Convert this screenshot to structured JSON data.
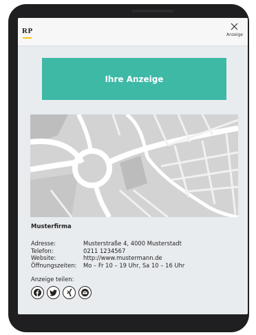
{
  "header": {
    "logo_text": "RP",
    "close_label": "Anzeige",
    "icons": {
      "close": "close-icon"
    }
  },
  "ad": {
    "label": "Ihre Anzeige",
    "color": "#3db9a6"
  },
  "company": {
    "name": "Musterfirma",
    "rows": [
      {
        "label": "Adresse:",
        "value": "Musterstraße 4, 4000 Musterstadt"
      },
      {
        "label": "Telefon:",
        "value": "0211 1234567"
      },
      {
        "label": "Website:",
        "value": "http://www.mustermann.de"
      },
      {
        "label": "Öffnungszeiten:",
        "value": "Mo – Fr 10 – 19 Uhr, Sa 10 – 16 Uhr"
      }
    ]
  },
  "share": {
    "label": "Anzeige teilen:",
    "buttons": [
      "facebook-icon",
      "twitter-icon",
      "xing-icon",
      "email-icon"
    ]
  },
  "colors": {
    "accent_yellow": "#f3c517",
    "screen_bg": "#e9ecef",
    "map_bg": "#d4d4d4"
  }
}
